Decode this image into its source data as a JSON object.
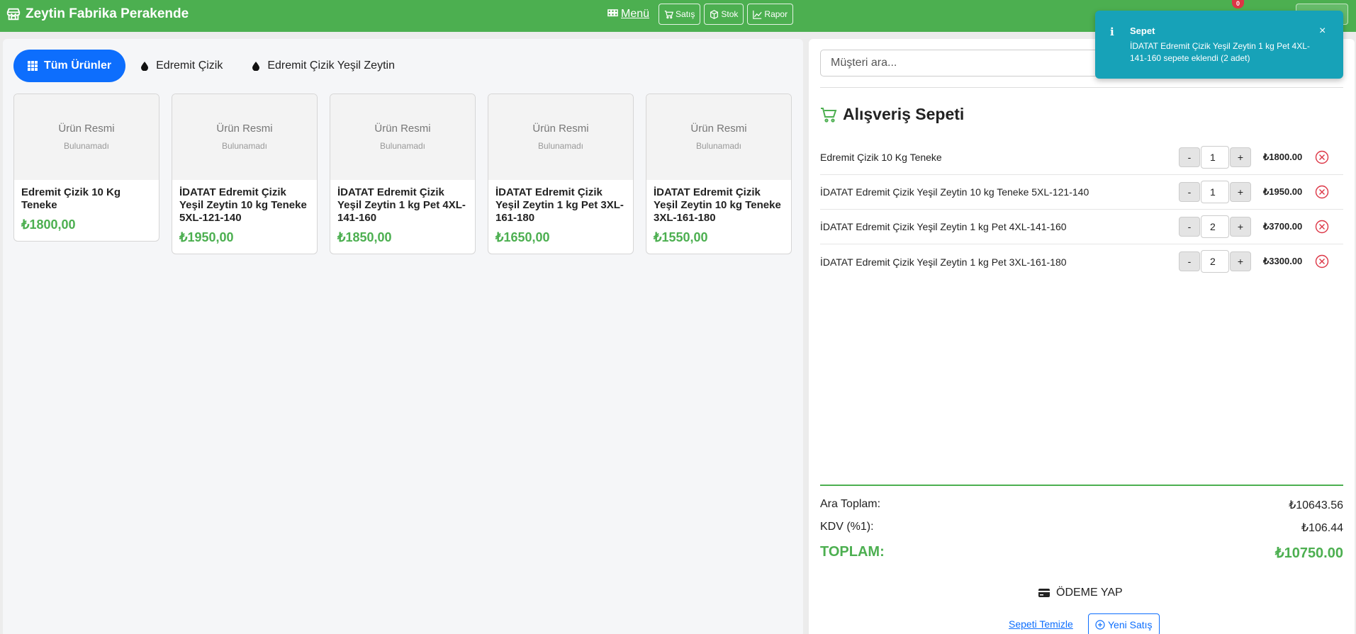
{
  "app": {
    "title": "Zeytin Fabrika Perakende",
    "brand_icon": "store-icon",
    "accent_color": "#4caf50",
    "primary_color": "#0d6efd"
  },
  "nav": {
    "menu_label": "Menü",
    "buttons": [
      {
        "label": "Satış",
        "icon": "cart-icon"
      },
      {
        "label": "Stok",
        "icon": "box-icon"
      },
      {
        "label": "Rapor",
        "icon": "chart-line-icon"
      }
    ],
    "notification_count": "0"
  },
  "categories": [
    {
      "label": "Tüm Ürünler",
      "icon": "grid-icon",
      "active": true
    },
    {
      "label": "Edremit Çizik",
      "icon": "drop-icon",
      "active": false
    },
    {
      "label": "Edremit Çizik Yeşil Zeytin",
      "icon": "drop-icon",
      "active": false
    }
  ],
  "products": [
    {
      "image_line1": "Ürün Resmi",
      "image_line2": "Bulunamadı",
      "name": "Edremit Çizik 10 Kg Teneke",
      "price": "₺1800,00"
    },
    {
      "image_line1": "Ürün Resmi",
      "image_line2": "Bulunamadı",
      "name": "İDATAT Edremit Çizik Yeşil Zeytin 10 kg Teneke 5XL-121-140",
      "price": "₺1950,00"
    },
    {
      "image_line1": "Ürün Resmi",
      "image_line2": "Bulunamadı",
      "name": "İDATAT Edremit Çizik Yeşil Zeytin 1 kg Pet 4XL-141-160",
      "price": "₺1850,00"
    },
    {
      "image_line1": "Ürün Resmi",
      "image_line2": "Bulunamadı",
      "name": "İDATAT Edremit Çizik Yeşil Zeytin 1 kg Pet 3XL-161-180",
      "price": "₺1650,00"
    },
    {
      "image_line1": "Ürün Resmi",
      "image_line2": "Bulunamadı",
      "name": "İDATAT Edremit Çizik Yeşil Zeytin 10 kg Teneke 3XL-161-180",
      "price": "₺1550,00"
    }
  ],
  "customer_search": {
    "placeholder": "Müşteri ara..."
  },
  "cart": {
    "title": "Alışveriş Sepeti",
    "items": [
      {
        "name": "Edremit Çizik 10 Kg Teneke",
        "qty": "1",
        "total": "₺1800.00"
      },
      {
        "name": "İDATAT Edremit Çizik Yeşil Zeytin 10 kg Teneke 5XL-121-140",
        "qty": "1",
        "total": "₺1950.00"
      },
      {
        "name": "İDATAT Edremit Çizik Yeşil Zeytin 1 kg Pet 4XL-141-160",
        "qty": "2",
        "total": "₺3700.00"
      },
      {
        "name": "İDATAT Edremit Çizik Yeşil Zeytin 1 kg Pet 3XL-161-180",
        "qty": "2",
        "total": "₺3300.00"
      }
    ],
    "minus_label": "-",
    "plus_label": "+",
    "subtotal_label": "Ara Toplam:",
    "subtotal": "₺10643.56",
    "tax_label": "KDV (%1):",
    "tax": "₺106.44",
    "grand_label": "TOPLAM:",
    "grand_total": "₺10750.00",
    "pay_label": "ÖDEME YAP",
    "clear_label": "Sepeti Temizle",
    "new_sale_label": "Yeni Satış"
  },
  "toast": {
    "icon": "info-icon",
    "title": "Sepet",
    "message": "İDATAT Edremit Çizik Yeşil Zeytin 1 kg Pet 4XL-141-160 sepete eklendi (2 adet)",
    "close": "×",
    "color": "#17a2b8"
  }
}
